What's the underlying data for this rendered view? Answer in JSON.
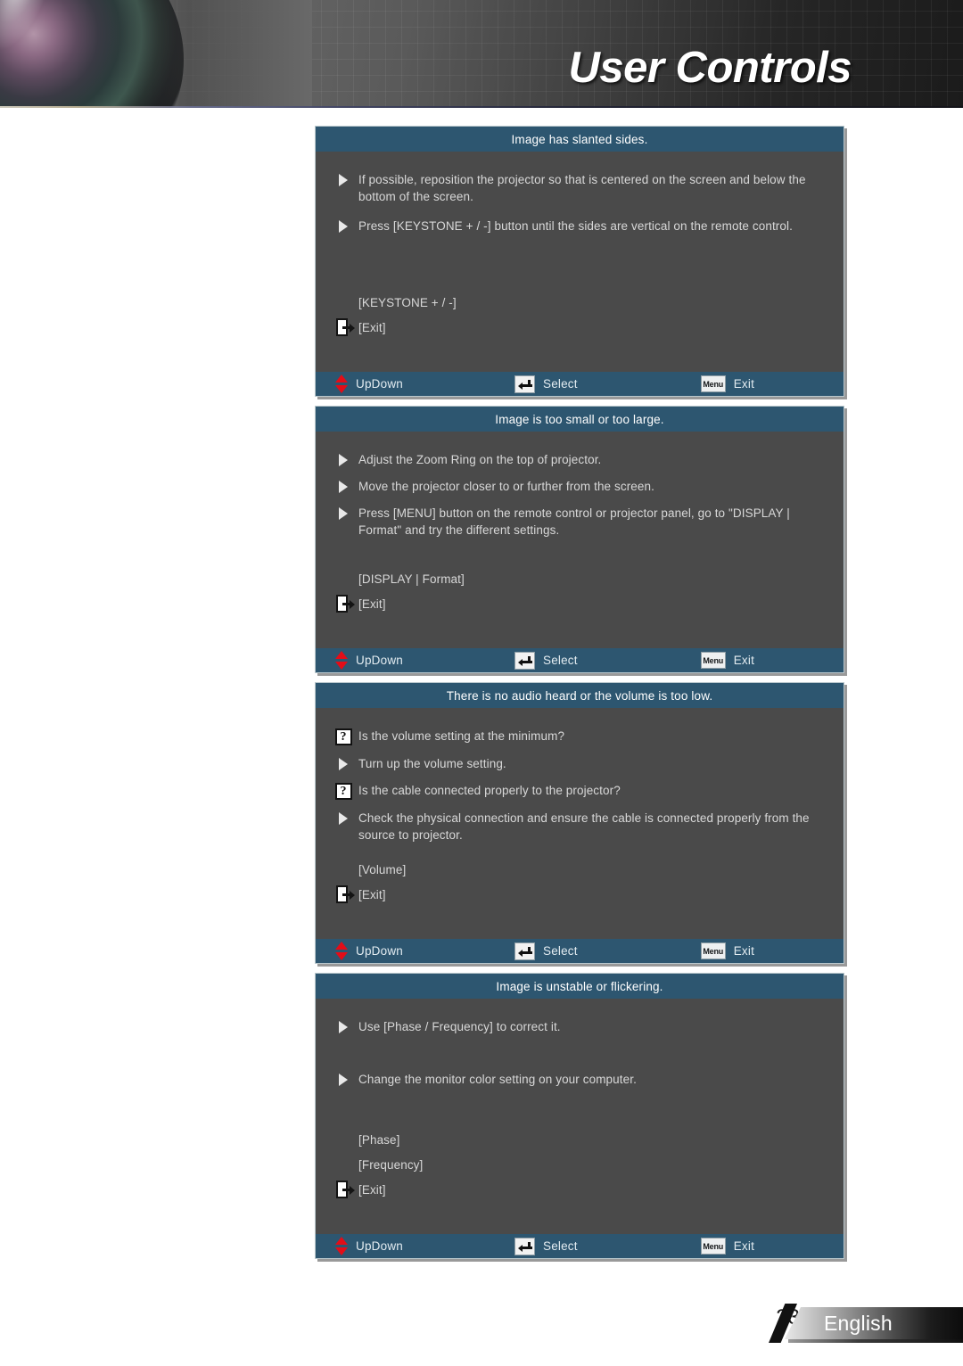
{
  "header": {
    "title": "User Controls",
    "lens_icon": "projector-lens-photo"
  },
  "navbar": {
    "updown_label": "UpDown",
    "select_label": "Select",
    "exit_label": "Exit",
    "updown_icon": "red-up-down-arrow-icon",
    "select_icon": "enter-key-icon",
    "exit_icon": "menu-key-icon",
    "menu_key_label": "Menu"
  },
  "colors": {
    "title_bar": "#2d5670",
    "panel_body": "#4a4a4a",
    "body_text": "#d8d8d8",
    "accent_red": "#e20d18",
    "panel_border": "#b9c7cc"
  },
  "panels": [
    {
      "title": "Image has slanted sides.",
      "items": [
        {
          "icon": "arrow-bullet-icon",
          "text": "If possible, reposition the projector so that is centered on the screen and below the bottom of the screen."
        },
        {
          "icon": "arrow-bullet-icon",
          "text": "Press [KEYSTONE + / -] button until the sides are vertical on the remote control."
        }
      ],
      "refs": [
        {
          "icon": "none",
          "label": "[KEYSTONE + / -]"
        },
        {
          "icon": "exit-door-icon",
          "label": "[Exit]"
        }
      ]
    },
    {
      "title": "Image is too small or too large.",
      "items": [
        {
          "icon": "arrow-bullet-icon",
          "text": "Adjust the Zoom Ring on the top of projector."
        },
        {
          "icon": "arrow-bullet-icon",
          "text": "Move the projector closer to or further from the screen."
        },
        {
          "icon": "arrow-bullet-icon",
          "text": "Press [MENU] button on the remote control or projector panel, go to \"DISPLAY | Format\" and try the different settings."
        }
      ],
      "refs": [
        {
          "icon": "none",
          "label": "[DISPLAY | Format]"
        },
        {
          "icon": "exit-door-icon",
          "label": "[Exit]"
        }
      ]
    },
    {
      "title": "There is no audio heard or the volume is too low.",
      "items": [
        {
          "icon": "question-mark-icon",
          "text": "Is the volume setting at the minimum?"
        },
        {
          "icon": "arrow-bullet-icon",
          "text": "Turn up the volume setting."
        },
        {
          "icon": "question-mark-icon",
          "text": "Is the cable connected properly to the projector?"
        },
        {
          "icon": "arrow-bullet-icon",
          "text": "Check the physical connection and ensure the cable is connected properly from the source to projector."
        }
      ],
      "refs": [
        {
          "icon": "none",
          "label": "[Volume]"
        },
        {
          "icon": "exit-door-icon",
          "label": "[Exit]"
        }
      ]
    },
    {
      "title": "Image is unstable or flickering.",
      "items": [
        {
          "icon": "arrow-bullet-icon",
          "text": "Use [Phase / Frequency] to correct it."
        },
        {
          "icon": "arrow-bullet-icon",
          "text": "Change the monitor color setting on your computer."
        }
      ],
      "refs": [
        {
          "icon": "none",
          "label": "[Phase]"
        },
        {
          "icon": "none",
          "label": "[Frequency]"
        },
        {
          "icon": "exit-door-icon",
          "label": "[Exit]"
        }
      ]
    }
  ],
  "footer": {
    "page_number": "23",
    "language": "English"
  }
}
